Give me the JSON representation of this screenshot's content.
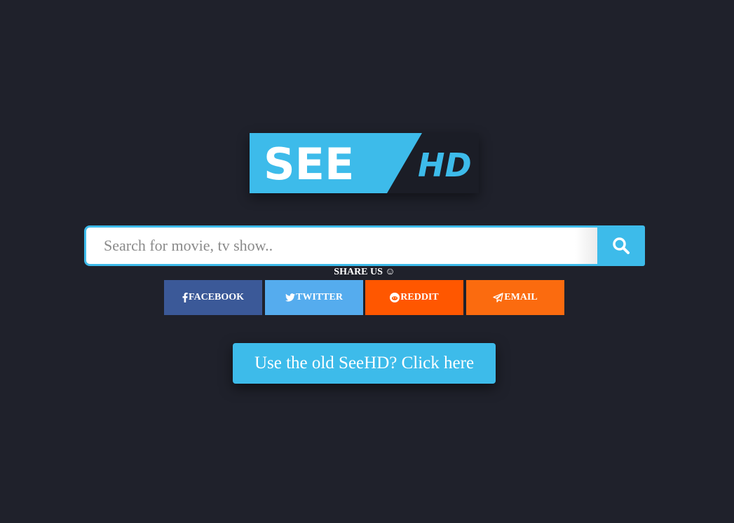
{
  "logo": {
    "text_left": "SEE",
    "text_right": "HD",
    "accent_color": "#3dbbea",
    "dark_color": "#1b1d26"
  },
  "search": {
    "placeholder": "Search for movie, tv show..",
    "value": "",
    "button_icon": "search-icon"
  },
  "share": {
    "title": "SHARE US ☺",
    "buttons": [
      {
        "label": "FACEBOOK",
        "icon": "facebook-icon",
        "color": "#3b5998"
      },
      {
        "label": "TWITTER",
        "icon": "twitter-icon",
        "color": "#55acee"
      },
      {
        "label": "REDDIT",
        "icon": "reddit-icon",
        "color": "#ff5700"
      },
      {
        "label": "EMAIL",
        "icon": "paper-plane-icon",
        "color": "#fb6b0f"
      }
    ]
  },
  "old_site": {
    "label": "Use the old SeeHD? Click here"
  },
  "colors": {
    "background": "#1f212b",
    "accent": "#3dbbea"
  }
}
